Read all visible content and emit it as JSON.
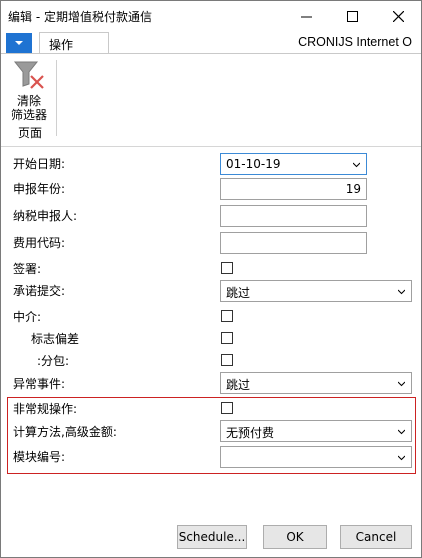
{
  "window": {
    "title": "编辑 - 定期增值税付款通信",
    "app_name": "CRONIJS Internet O"
  },
  "ribbon": {
    "tab_label": "操作",
    "clear_filter_line1": "清除",
    "clear_filter_line2": "筛选器",
    "group_label": "页面"
  },
  "form": {
    "start_date_label": "开始日期:",
    "start_date_value": "01-10-19",
    "report_year_label": "申报年份:",
    "report_year_value": "19",
    "taxpayer_label": "纳税申报人:",
    "taxpayer_value": "",
    "fee_code_label": "费用代码:",
    "fee_code_value": "",
    "signature_label": "签署:",
    "commitment_label": "承诺提交:",
    "commitment_value": "跳过",
    "intermediary_label": "中介:",
    "flag_deviation_label": "标志偏差",
    "subsidiary_label": ":分包:",
    "abnormal_event_label": "异常事件:",
    "abnormal_event_value": "跳过",
    "irregular_label": "非常规操作:",
    "calc_method_label": "计算方法,高级金额:",
    "calc_method_value": "无预付费",
    "module_no_label": "模块编号:",
    "module_no_value": ""
  },
  "buttons": {
    "schedule": "Schedule...",
    "ok": "OK",
    "cancel": "Cancel"
  },
  "colors": {
    "accent_blue": "#1f73d2",
    "highlight_red": "#cc2222"
  }
}
